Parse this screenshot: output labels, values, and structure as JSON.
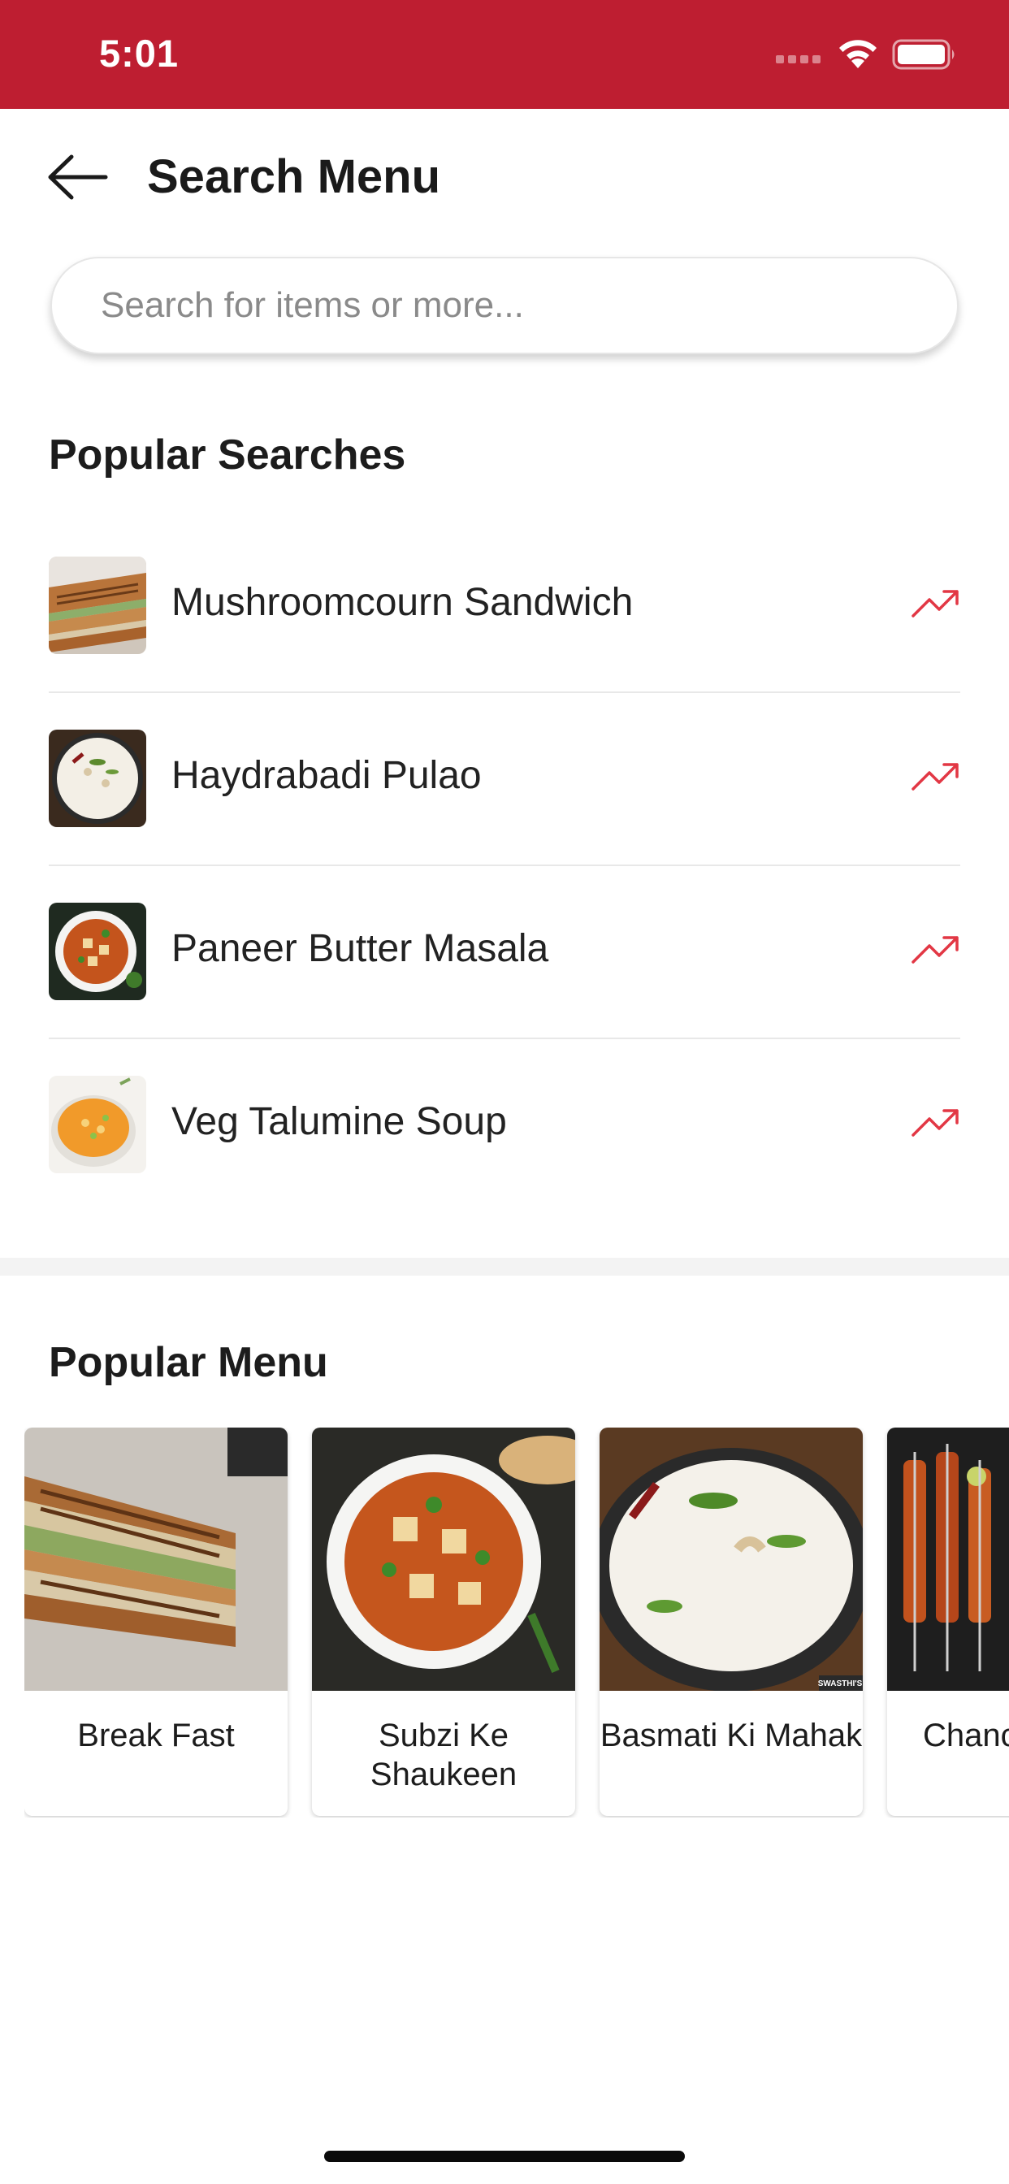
{
  "status_bar": {
    "time": "5:01",
    "background": "#be1e31"
  },
  "header": {
    "title": "Search Menu",
    "back_icon": "arrow-left-icon"
  },
  "search": {
    "placeholder": "Search for items or more...",
    "value": ""
  },
  "popular_searches": {
    "title": "Popular Searches",
    "trend_icon": "trending-up-icon",
    "trend_color": "#e23744",
    "items": [
      {
        "label": "Mushroomcourn Sandwich",
        "image": "sandwich-thumbnail"
      },
      {
        "label": "Haydrabadi Pulao",
        "image": "pulao-thumbnail"
      },
      {
        "label": "Paneer Butter Masala",
        "image": "paneer-masala-thumbnail"
      },
      {
        "label": "Veg Talumine Soup",
        "image": "soup-thumbnail"
      }
    ]
  },
  "popular_menu": {
    "title": "Popular Menu",
    "items": [
      {
        "name": "Break Fast",
        "image": "sandwich-photo"
      },
      {
        "name": "Subzi Ke Shaukeen",
        "image": "paneer-curry-photo"
      },
      {
        "name": "Basmati Ki Mahak",
        "image": "rice-photo"
      },
      {
        "name": "Chanc Spe",
        "image": "tikka-skewers-photo"
      }
    ],
    "rice_photo_watermark": "SWASTHI'S"
  }
}
